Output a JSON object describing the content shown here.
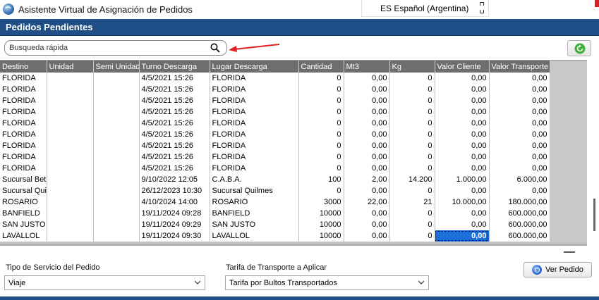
{
  "window": {
    "title": "Asistente Virtual de Asignación de Pedidos",
    "language": "ES Español (Argentina)"
  },
  "header": {
    "title": "Pedidos Pendientes"
  },
  "search": {
    "placeholder": "Busqueda rápida",
    "value": ""
  },
  "grid": {
    "columns": [
      "Destino",
      "Unidad",
      "Semi Unidad",
      "Turno Descarga",
      "Lugar Descarga",
      "Cantidad",
      "Mt3",
      "Kg",
      "Valor Cliente",
      "Valor Transporte"
    ],
    "rows": [
      [
        "FLORIDA",
        "",
        "",
        "4/5/2021 15:26",
        "FLORIDA",
        "0",
        "0,00",
        "0",
        "0,00",
        "0,00"
      ],
      [
        "FLORIDA",
        "",
        "",
        "4/5/2021 15:26",
        "FLORIDA",
        "0",
        "0,00",
        "0",
        "0,00",
        "0,00"
      ],
      [
        "FLORIDA",
        "",
        "",
        "4/5/2021 15:26",
        "FLORIDA",
        "0",
        "0,00",
        "0",
        "0,00",
        "0,00"
      ],
      [
        "FLORIDA",
        "",
        "",
        "4/5/2021 15:26",
        "FLORIDA",
        "0",
        "0,00",
        "0",
        "0,00",
        "0,00"
      ],
      [
        "FLORIDA",
        "",
        "",
        "4/5/2021 15:26",
        "FLORIDA",
        "0",
        "0,00",
        "0",
        "0,00",
        "0,00"
      ],
      [
        "FLORIDA",
        "",
        "",
        "4/5/2021 15:26",
        "FLORIDA",
        "0",
        "0,00",
        "0",
        "0,00",
        "0,00"
      ],
      [
        "FLORIDA",
        "",
        "",
        "4/5/2021 15:26",
        "FLORIDA",
        "0",
        "0,00",
        "0",
        "0,00",
        "0,00"
      ],
      [
        "FLORIDA",
        "",
        "",
        "4/5/2021 15:26",
        "FLORIDA",
        "0",
        "0,00",
        "0",
        "0,00",
        "0,00"
      ],
      [
        "FLORIDA",
        "",
        "",
        "4/5/2021 15:26",
        "FLORIDA",
        "0",
        "0,00",
        "0",
        "0,00",
        "0,00"
      ],
      [
        "Sucursal Beta",
        "",
        "",
        "9/10/2022 12:05",
        "C.A.B.A.",
        "100",
        "2,00",
        "14.200",
        "1.000,00",
        "6.000,00"
      ],
      [
        "Sucursal Quilmes",
        "",
        "",
        "26/12/2023 10:30",
        "Sucursal Quilmes",
        "0",
        "0,00",
        "0",
        "0,00",
        "0,00"
      ],
      [
        "ROSARIO",
        "",
        "",
        "4/10/2024 14:00",
        "ROSARIO",
        "3000",
        "22,00",
        "21",
        "10.000,00",
        "180.000,00"
      ],
      [
        "BANFIELD",
        "",
        "",
        "19/11/2024 09:28",
        "BANFIELD",
        "10000",
        "0,00",
        "0",
        "0,00",
        "600.000,00"
      ],
      [
        "SAN JUSTO",
        "",
        "",
        "19/11/2024 09:29",
        "SAN JUSTO",
        "10000",
        "0,00",
        "0",
        "0,00",
        "600.000,00"
      ],
      [
        "LAVALLOL",
        "",
        "",
        "19/11/2024 09:30",
        "LAVALLOL",
        "10000",
        "0,00",
        "0",
        "0,00",
        "600.000,00"
      ]
    ],
    "selected_cell": {
      "row": 14,
      "col": 8
    }
  },
  "footer": {
    "service_label": "Tipo de Servicio del Pedido",
    "service_value": "Viaje",
    "tariff_label": "Tarifa de Transporte a Aplicar",
    "tariff_value": "Tarifa por Bultos Transportados",
    "view_button": "Ver Pedido"
  },
  "colors": {
    "header_blue": "#1f4f86",
    "grid_header": "#6e6e6e",
    "selection": "#1c6fd6",
    "annotation_arrow": "#e02020"
  }
}
